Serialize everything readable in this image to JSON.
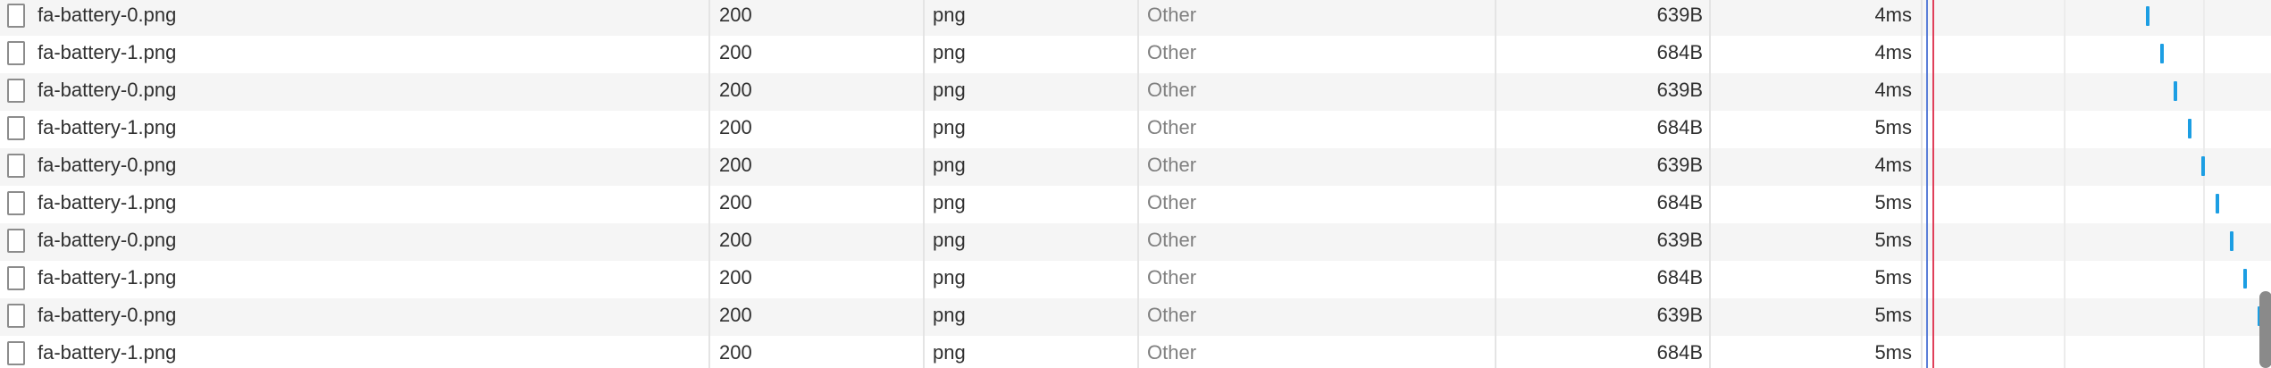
{
  "network_requests": [
    {
      "name": "fa-battery-0.png",
      "status": "200",
      "type": "png",
      "initiator": "Other",
      "size": "639B",
      "time": "4ms"
    },
    {
      "name": "fa-battery-1.png",
      "status": "200",
      "type": "png",
      "initiator": "Other",
      "size": "684B",
      "time": "4ms"
    },
    {
      "name": "fa-battery-0.png",
      "status": "200",
      "type": "png",
      "initiator": "Other",
      "size": "639B",
      "time": "4ms"
    },
    {
      "name": "fa-battery-1.png",
      "status": "200",
      "type": "png",
      "initiator": "Other",
      "size": "684B",
      "time": "5ms"
    },
    {
      "name": "fa-battery-0.png",
      "status": "200",
      "type": "png",
      "initiator": "Other",
      "size": "639B",
      "time": "4ms"
    },
    {
      "name": "fa-battery-1.png",
      "status": "200",
      "type": "png",
      "initiator": "Other",
      "size": "684B",
      "time": "5ms"
    },
    {
      "name": "fa-battery-0.png",
      "status": "200",
      "type": "png",
      "initiator": "Other",
      "size": "639B",
      "time": "5ms"
    },
    {
      "name": "fa-battery-1.png",
      "status": "200",
      "type": "png",
      "initiator": "Other",
      "size": "684B",
      "time": "5ms"
    },
    {
      "name": "fa-battery-0.png",
      "status": "200",
      "type": "png",
      "initiator": "Other",
      "size": "639B",
      "time": "5ms"
    },
    {
      "name": "fa-battery-1.png",
      "status": "200",
      "type": "png",
      "initiator": "Other",
      "size": "684B",
      "time": "5ms"
    }
  ],
  "row_icon": "file-icon",
  "colors": {
    "row_even": "#f5f5f5",
    "row_odd": "#ffffff",
    "text": "#303030",
    "initiator_text": "#808080",
    "waterfall_bar": "#1c9ee3",
    "marker_blue": "#5b7fd8",
    "marker_red": "#e0405a",
    "scrollbar_thumb": "#8a8a8a"
  }
}
